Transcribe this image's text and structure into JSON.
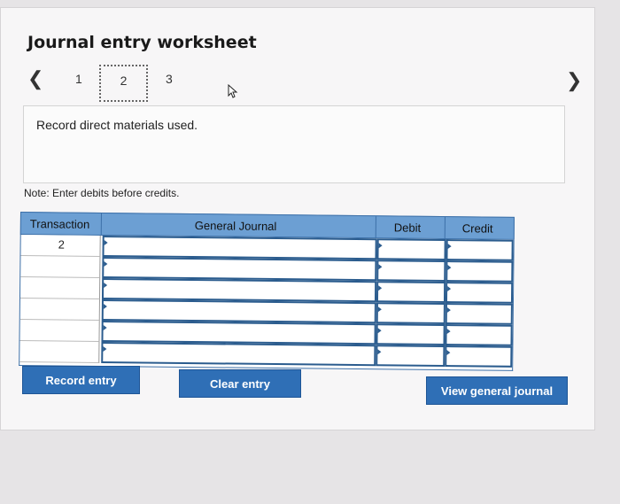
{
  "title": "Journal entry worksheet",
  "steps": [
    "1",
    "2",
    "3"
  ],
  "active_step": "2",
  "instruction": "Record direct materials used.",
  "note": "Note: Enter debits before credits.",
  "table": {
    "columns": [
      "Transaction",
      "General Journal",
      "Debit",
      "Credit"
    ],
    "rows": [
      {
        "transaction": "2",
        "account": "",
        "debit": "",
        "credit": ""
      },
      {
        "transaction": "",
        "account": "",
        "debit": "",
        "credit": ""
      },
      {
        "transaction": "",
        "account": "",
        "debit": "",
        "credit": ""
      },
      {
        "transaction": "",
        "account": "",
        "debit": "",
        "credit": ""
      },
      {
        "transaction": "",
        "account": "",
        "debit": "",
        "credit": ""
      },
      {
        "transaction": "",
        "account": "",
        "debit": "",
        "credit": ""
      }
    ]
  },
  "buttons": {
    "record": "Record entry",
    "clear": "Clear entry",
    "view": "View general journal"
  },
  "colors": {
    "header": "#6c9fd3",
    "button": "#2f6fb6"
  }
}
